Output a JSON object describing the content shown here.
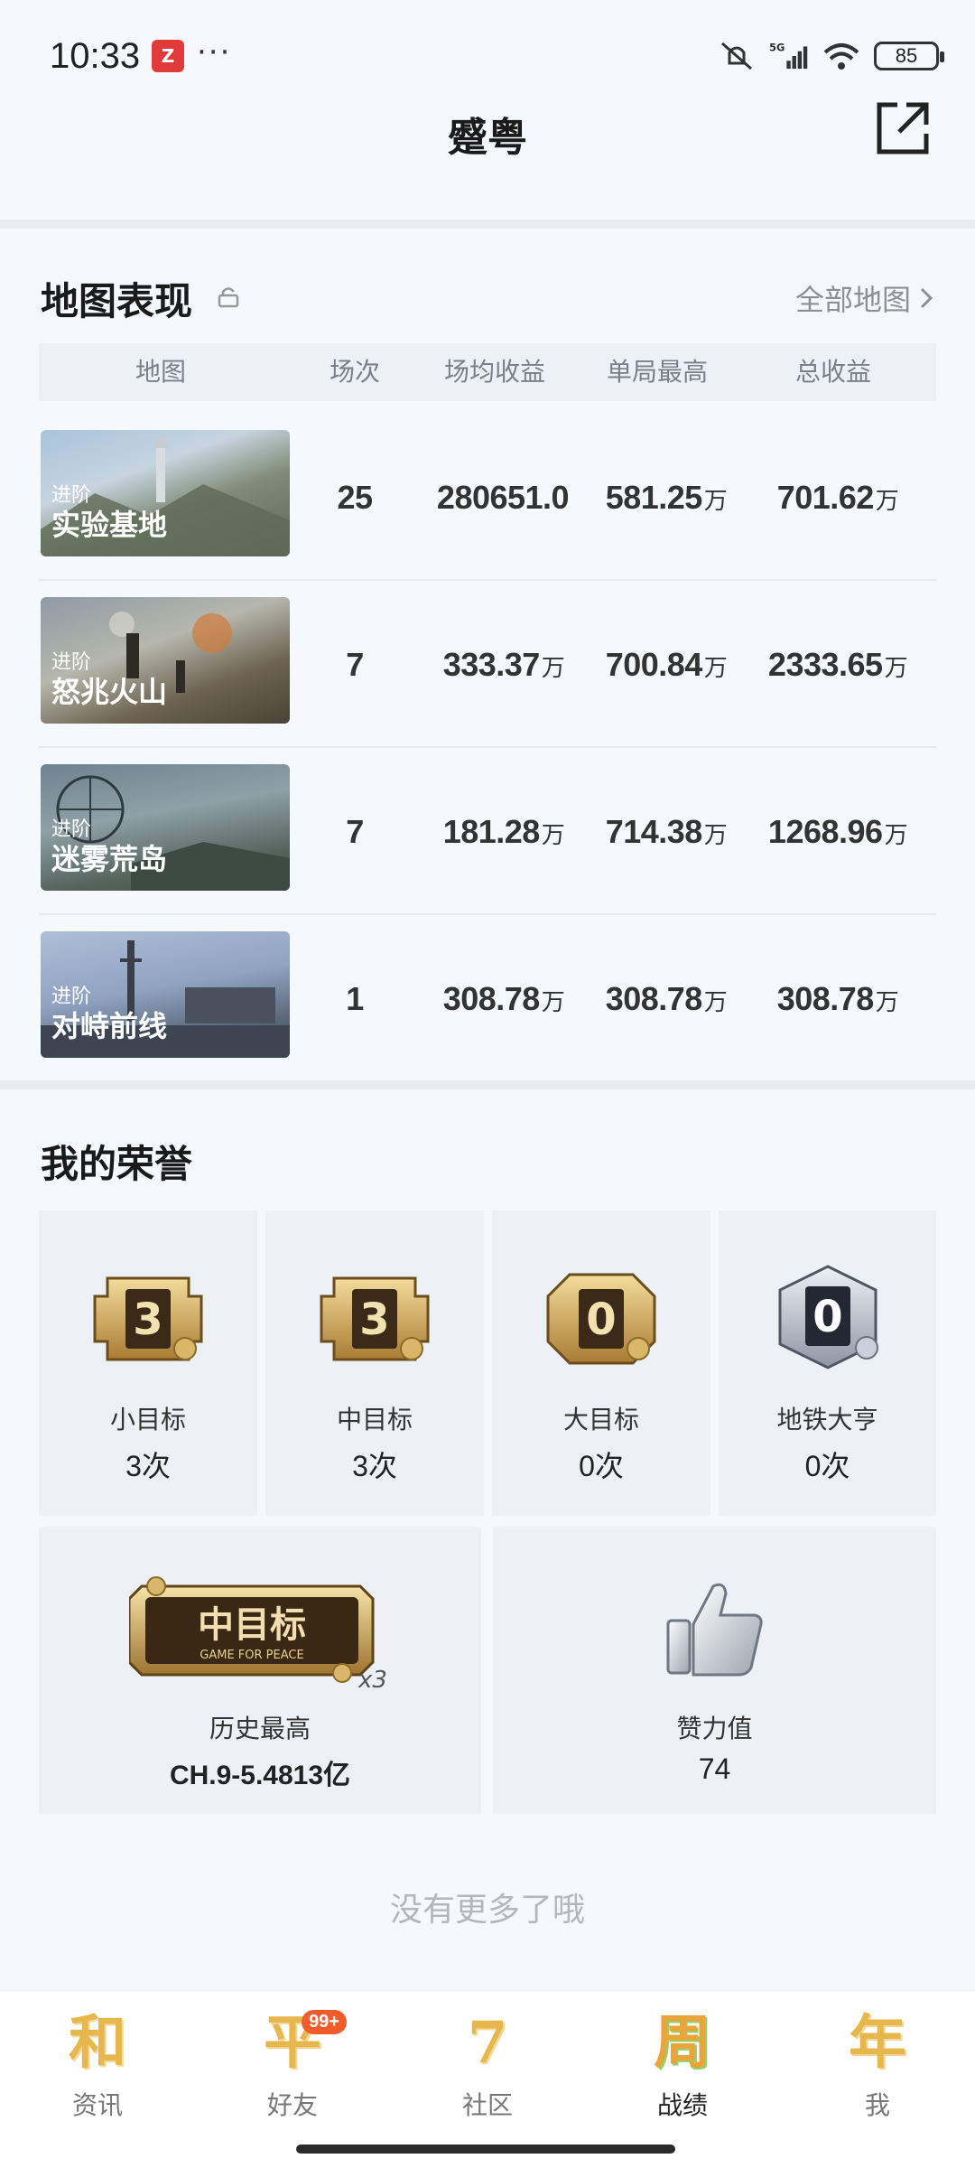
{
  "status_bar": {
    "time": "10:33",
    "dots": "···",
    "network": "5G",
    "battery": "85"
  },
  "header": {
    "title": "蹙粤"
  },
  "map_section": {
    "title": "地图表现",
    "all_maps_link": "全部地图",
    "columns": [
      "地图",
      "场次",
      "场均收益",
      "单局最高",
      "总收益"
    ],
    "rows": [
      {
        "tag": "进阶",
        "name": "实验基地",
        "matches": "25",
        "avg": "280651.0",
        "avg_unit": "",
        "best": "581.25",
        "best_unit": "万",
        "total": "701.62",
        "total_unit": "万"
      },
      {
        "tag": "进阶",
        "name": "怒兆火山",
        "matches": "7",
        "avg": "333.37",
        "avg_unit": "万",
        "best": "700.84",
        "best_unit": "万",
        "total": "2333.65",
        "total_unit": "万"
      },
      {
        "tag": "进阶",
        "name": "迷雾荒岛",
        "matches": "7",
        "avg": "181.28",
        "avg_unit": "万",
        "best": "714.38",
        "best_unit": "万",
        "total": "1268.96",
        "total_unit": "万"
      },
      {
        "tag": "进阶",
        "name": "对峙前线",
        "matches": "1",
        "avg": "308.78",
        "avg_unit": "万",
        "best": "308.78",
        "best_unit": "万",
        "total": "308.78",
        "total_unit": "万"
      }
    ]
  },
  "honor_section": {
    "title": "我的荣誉",
    "badges": [
      {
        "number": "3",
        "label": "小目标",
        "count": "3次",
        "style": "gold"
      },
      {
        "number": "3",
        "label": "中目标",
        "count": "3次",
        "style": "gold"
      },
      {
        "number": "0",
        "label": "大目标",
        "count": "0次",
        "style": "gold"
      },
      {
        "number": "0",
        "label": "地铁大亨",
        "count": "0次",
        "style": "silver"
      }
    ],
    "history": {
      "plaque_text": "中目标",
      "plaque_sub": "GAME FOR PEACE",
      "multiplier": "x3",
      "label": "历史最高",
      "value": "CH.9-5.4813亿"
    },
    "likes": {
      "label": "赞力值",
      "value": "74"
    }
  },
  "no_more_text": "没有更多了哦",
  "tabbar": [
    {
      "glyph": "和",
      "label": "资讯",
      "badge": ""
    },
    {
      "glyph": "平",
      "label": "好友",
      "badge": "99+"
    },
    {
      "glyph": "7",
      "label": "社区",
      "badge": ""
    },
    {
      "glyph": "周",
      "label": "战绩",
      "badge": ""
    },
    {
      "glyph": "年",
      "label": "我",
      "badge": ""
    }
  ],
  "colors": {
    "accent_gold": "#e6b74c",
    "badge_orange": "#f25c2a",
    "muted_text": "#8c8f94"
  }
}
